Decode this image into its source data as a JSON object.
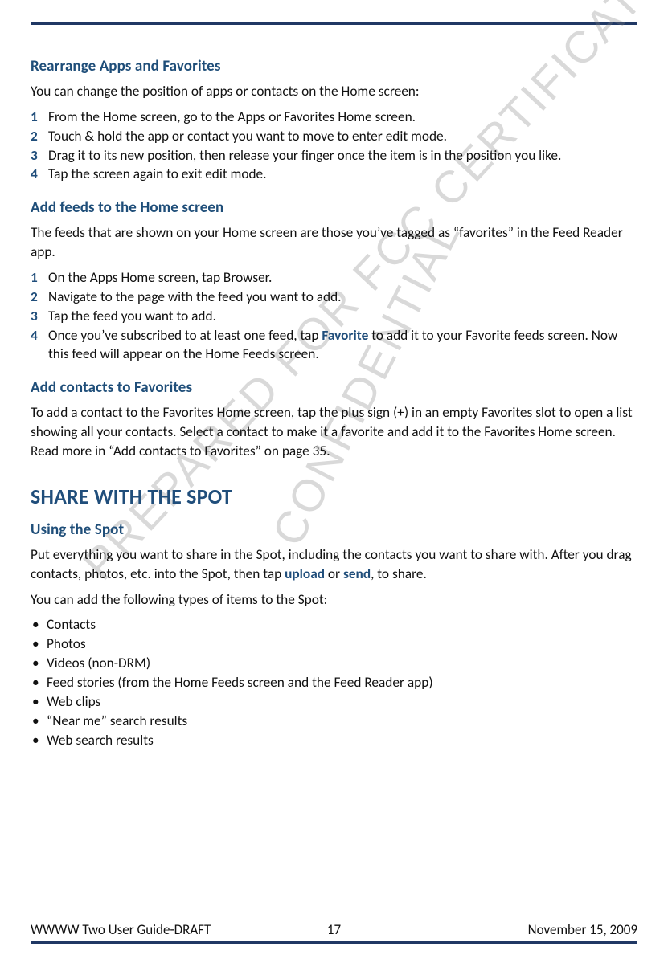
{
  "watermarks": {
    "wm1": "PREPARED FOR FCC CERTIFICATION",
    "wm2": "CONFIDENTIAL"
  },
  "sections": {
    "rearrange": {
      "heading": "Rearrange Apps and Favorites",
      "intro": "You can change the position of apps or contacts on the Home screen:",
      "steps": [
        "From the Home screen, go to the Apps or Favorites Home screen.",
        "Touch & hold the app or contact you want to move to enter edit mode.",
        "Drag it to its new position, then release your finger once the item is in the position you like.",
        "Tap the screen again to exit edit mode."
      ]
    },
    "addFeeds": {
      "heading": "Add feeds to the Home screen",
      "intro": "The feeds that are shown on your Home screen are those you’ve tagged as “favorites” in the Feed Reader app.",
      "steps": [
        "On the Apps Home screen, tap Browser.",
        "Navigate to the page with the feed you want to add.",
        "Tap the feed you want to add."
      ],
      "step4_prefix": "Once you’ve subscribed to at least one feed, tap ",
      "step4_bold": "Favorite",
      "step4_suffix": " to add it to your Favorite feeds screen. Now this feed will appear on the Home Feeds screen."
    },
    "addContacts": {
      "heading": "Add contacts to Favorites",
      "body": "To add a contact to the Favorites Home screen, tap the plus sign (+) in an empty Favorites slot to open a list showing all your contacts. Select a contact to make it a favorite and add it to the Favorites Home screen. Read more in “Add contacts to Favorites” on page 35."
    },
    "share": {
      "major": "SHARE WITH THE SPOT",
      "heading": "Using the Spot",
      "p1_prefix": "Put everything you want to share in the Spot, including the contacts you want to share with. After you drag contacts, photos, etc. into the Spot, then tap ",
      "p1_bold1": "upload",
      "p1_mid": " or ",
      "p1_bold2": "send",
      "p1_suffix": ", to share.",
      "p2": "You can add the following types of items to the Spot:",
      "items": [
        "Contacts",
        "Photos",
        "Videos (non-DRM)",
        "Feed stories (from the Home Feeds screen and the Feed Reader app)",
        "Web clips",
        "“Near me” search results",
        "Web search results"
      ]
    }
  },
  "footer": {
    "left": "WWWW Two User Guide-DRAFT",
    "center": "17",
    "right": "November 15, 2009"
  }
}
